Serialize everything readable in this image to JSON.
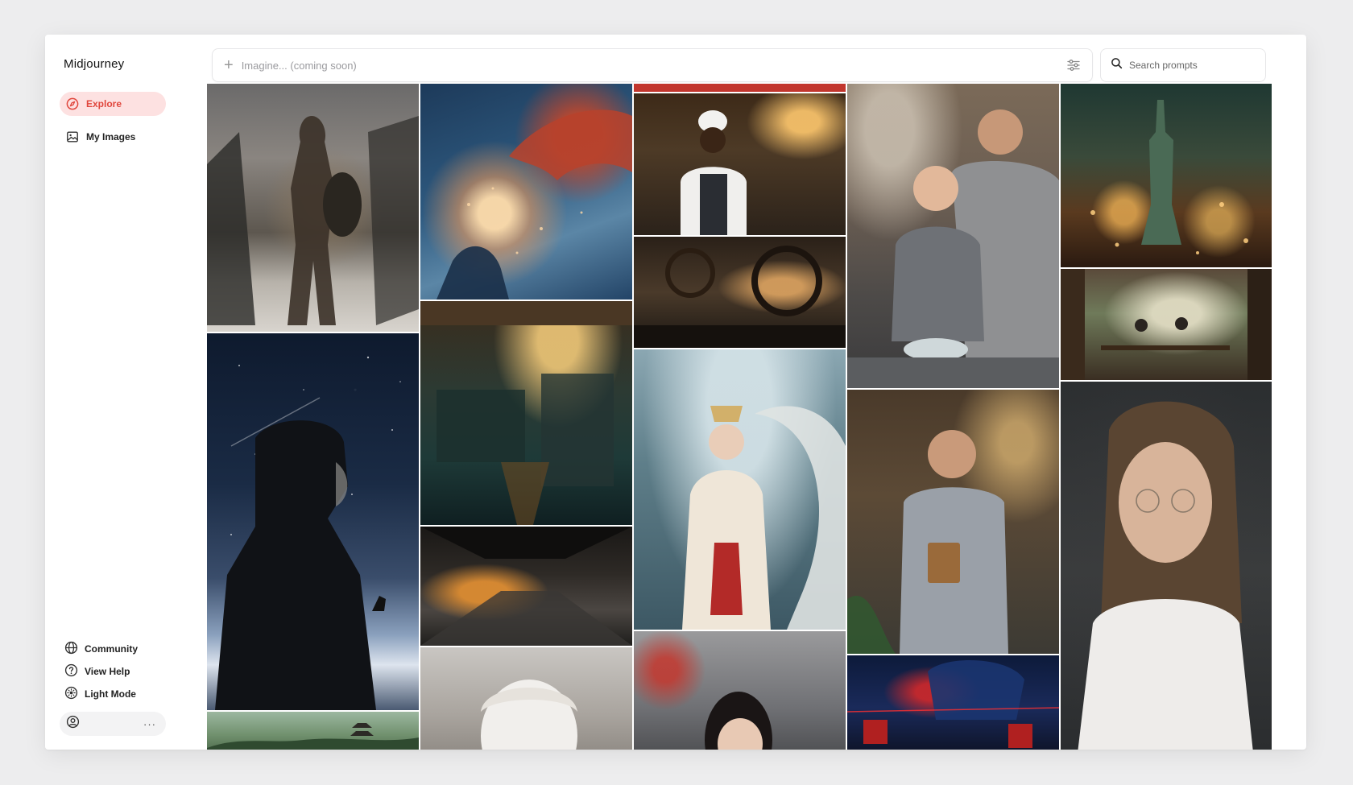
{
  "app": {
    "name": "Midjourney"
  },
  "sidebar": {
    "nav": [
      {
        "label": "Explore",
        "icon": "compass-icon",
        "active": true
      },
      {
        "label": "My Images",
        "icon": "image-icon",
        "active": false
      }
    ],
    "bottom": [
      {
        "label": "Community",
        "icon": "globe-icon"
      },
      {
        "label": "View Help",
        "icon": "help-circle-icon"
      },
      {
        "label": "Light Mode",
        "icon": "sun-icon"
      }
    ],
    "account": {
      "icon": "user-circle-icon",
      "more": "···"
    }
  },
  "topbar": {
    "imagine_placeholder": "Imagine... (coming soon)",
    "imagine_icon": "plus-icon",
    "settings_icon": "sliders-icon",
    "search_placeholder": "Search prompts",
    "search_icon": "search-icon"
  },
  "colors": {
    "accent": "#e0463c",
    "accent_bg": "#fde1e1"
  },
  "gallery": [
    {
      "subject": "spartan-warrior-battlefield"
    },
    {
      "subject": "night-sky-man-with-dog"
    },
    {
      "subject": "misty-pagoda-landscape"
    },
    {
      "subject": "fiery-dragon-nebula"
    },
    {
      "subject": "cinematic-interior-scene"
    },
    {
      "subject": "futuristic-corridor"
    },
    {
      "subject": "white-haired-sculpture"
    },
    {
      "subject": "smiling-chef-kitchen"
    },
    {
      "subject": "steampunk-gears-hall"
    },
    {
      "subject": "princess-with-white-dragon"
    },
    {
      "subject": "woman-street-portrait"
    },
    {
      "subject": "father-son-cooking"
    },
    {
      "subject": "man-holding-book"
    },
    {
      "subject": "scientist-red-laser"
    },
    {
      "subject": "statue-of-liberty-fireworks"
    },
    {
      "subject": "cafe-terrace-diners"
    },
    {
      "subject": "woman-with-glasses-portrait"
    }
  ]
}
